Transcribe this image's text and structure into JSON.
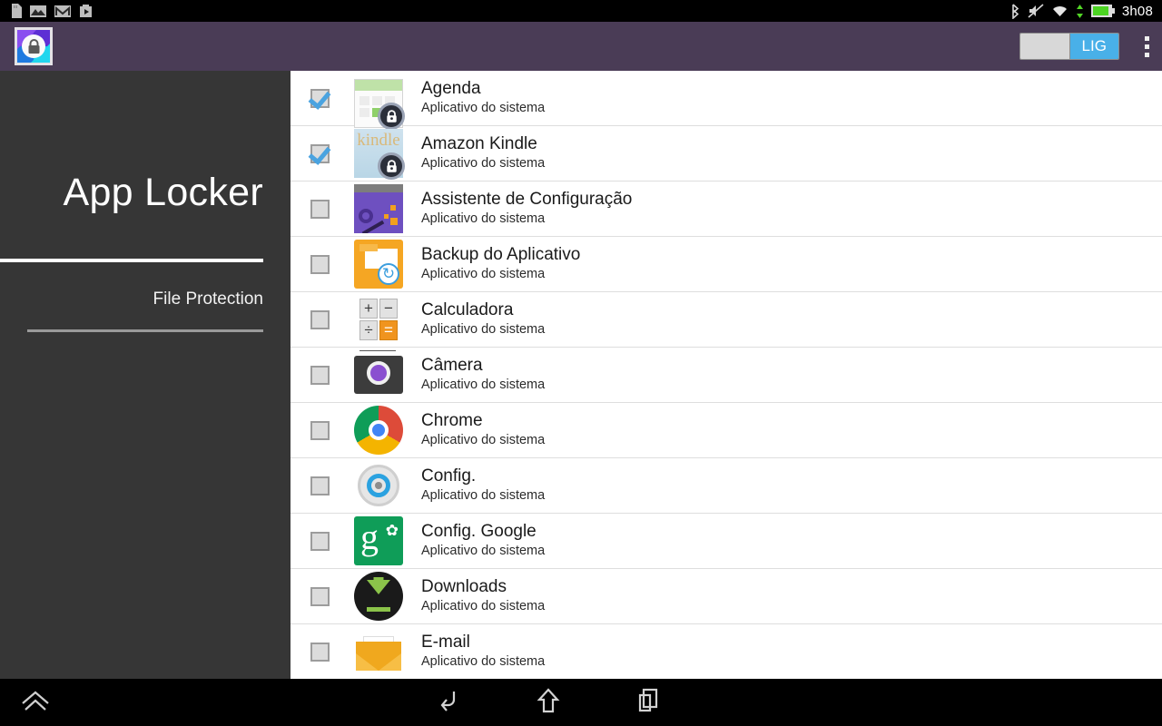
{
  "statusbar": {
    "left_icons": [
      "sdcard-icon",
      "gallery-icon",
      "gmail-icon",
      "play-store-icon"
    ],
    "right_icons": [
      "bluetooth-icon",
      "mute-icon",
      "wifi-icon",
      "data-transfer-icon",
      "battery-icon"
    ],
    "clock": "3h08"
  },
  "actionbar": {
    "app_icon_name": "app-locker-logo",
    "toggle": {
      "on_label": "LIG",
      "state": "on",
      "accent_color": "#49b0e8"
    },
    "overflow_label": "overflow-menu"
  },
  "sidebar": {
    "title": "App Locker",
    "subtitle": "File Protection",
    "background_color": "#363636"
  },
  "header_color": "#4a3c56",
  "list": {
    "subtitle_default": "Aplicativo do sistema",
    "items": [
      {
        "name": "Agenda",
        "subtitle": "Aplicativo do sistema",
        "checked": true,
        "icon": "calendar-icon",
        "locked": true
      },
      {
        "name": "Amazon Kindle",
        "subtitle": "Aplicativo do sistema",
        "checked": true,
        "icon": "kindle-icon",
        "locked": true
      },
      {
        "name": "Assistente de Configuração",
        "subtitle": "Aplicativo do sistema",
        "checked": false,
        "icon": "setup-wizard-icon",
        "locked": false
      },
      {
        "name": "Backup do Aplicativo",
        "subtitle": "Aplicativo do sistema",
        "checked": false,
        "icon": "app-backup-icon",
        "locked": false
      },
      {
        "name": "Calculadora",
        "subtitle": "Aplicativo do sistema",
        "checked": false,
        "icon": "calculator-icon",
        "locked": false
      },
      {
        "name": "Câmera",
        "subtitle": "Aplicativo do sistema",
        "checked": false,
        "icon": "camera-icon",
        "locked": false
      },
      {
        "name": "Chrome",
        "subtitle": "Aplicativo do sistema",
        "checked": false,
        "icon": "chrome-icon",
        "locked": false
      },
      {
        "name": "Config.",
        "subtitle": "Aplicativo do sistema",
        "checked": false,
        "icon": "settings-gear-icon",
        "locked": false
      },
      {
        "name": "Config. Google",
        "subtitle": "Aplicativo do sistema",
        "checked": false,
        "icon": "google-settings-icon",
        "locked": false
      },
      {
        "name": "Downloads",
        "subtitle": "Aplicativo do sistema",
        "checked": false,
        "icon": "downloads-icon",
        "locked": false
      },
      {
        "name": "E-mail",
        "subtitle": "Aplicativo do sistema",
        "checked": false,
        "icon": "email-icon",
        "locked": false
      }
    ]
  },
  "calculator_keys": {
    "plus": "+",
    "minus": "−",
    "divide": "÷",
    "equals": "="
  },
  "navbar": {
    "expand_label": "expand-up",
    "back_label": "back",
    "home_label": "home",
    "recents_label": "recent-apps"
  }
}
